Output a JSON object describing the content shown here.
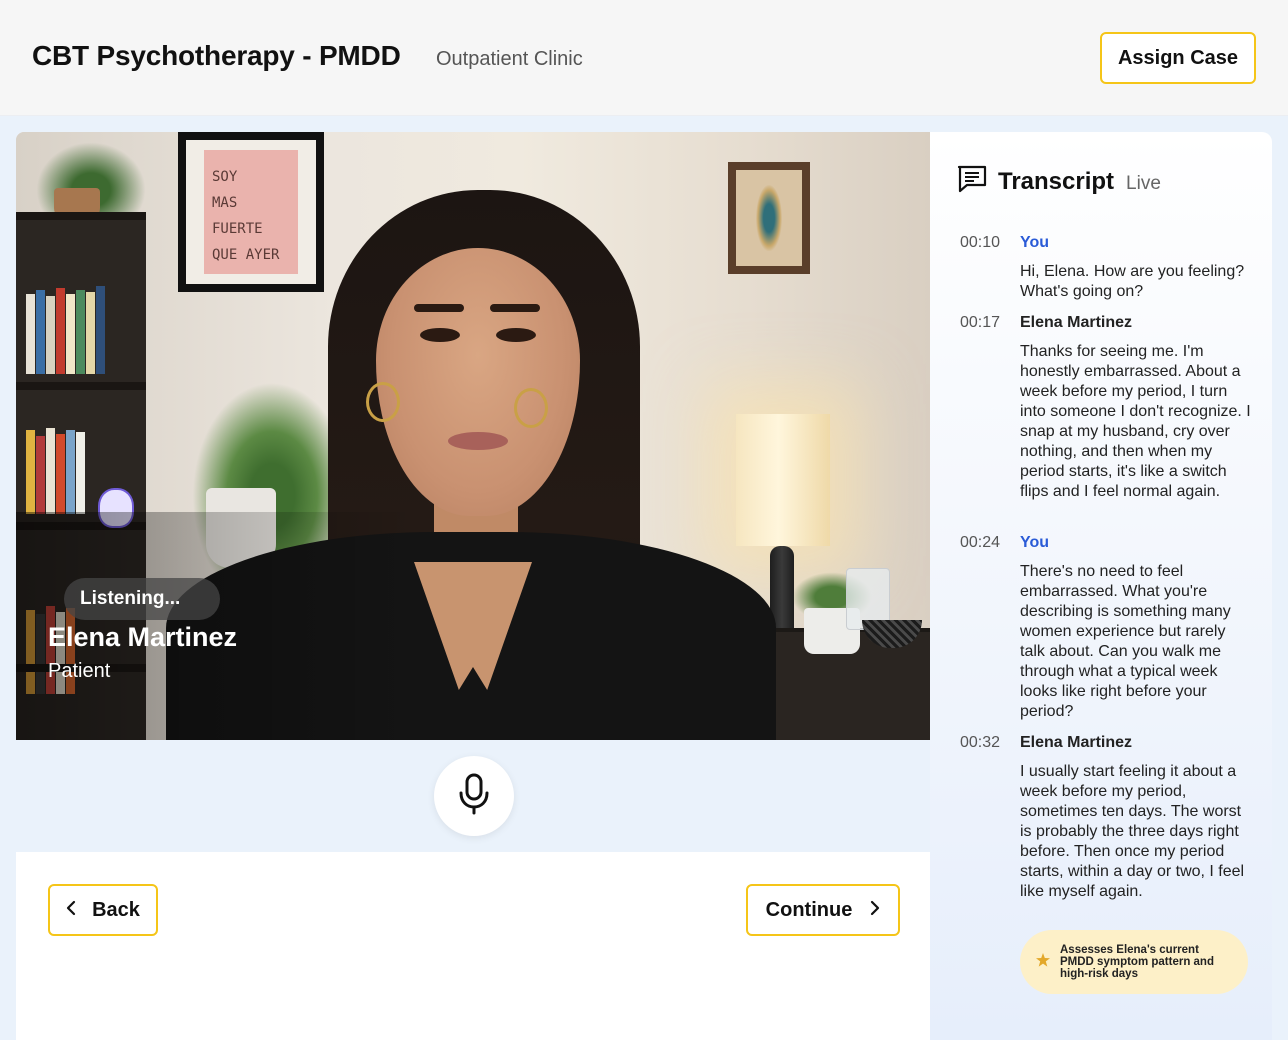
{
  "header": {
    "title": "CBT Psychotherapy - PMDD",
    "subtitle": "Outpatient Clinic",
    "assign_label": "Assign Case"
  },
  "video": {
    "status": "Listening...",
    "patient_name": "Elena Martinez",
    "patient_role": "Patient",
    "poster_lines": [
      "SOY",
      "MAS",
      "FUERTE",
      "QUE AYER"
    ]
  },
  "nav": {
    "back_label": "Back",
    "continue_label": "Continue"
  },
  "transcript": {
    "title": "Transcript",
    "status": "Live",
    "messages": [
      {
        "time": "00:10",
        "speaker": "You",
        "text": "Hi, Elena. How are you feeling? What's going on?"
      },
      {
        "time": "00:17",
        "speaker": "Elena Martinez",
        "text": "Thanks for seeing me. I'm honestly embarrassed. About a week before my period, I turn into someone I don't recognize. I snap at my husband, cry over nothing, and then when my period starts, it's like a switch flips and I feel normal again."
      },
      {
        "time": "00:24",
        "speaker": "You",
        "text": "There's no need to feel embarrassed. What you're describing is something many women experience but rarely talk about. Can you walk me through what a typical week looks like right before your period?"
      },
      {
        "time": "00:32",
        "speaker": "Elena Martinez",
        "text": "I usually start feeling it about a week before my period, sometimes ten days. The worst is probably the three days right before. Then once my period starts, within a day or two, I feel like myself again."
      }
    ],
    "badge": "Assesses Elena's current PMDD symptom pattern and high-risk days"
  },
  "colors": {
    "accent_border": "#f5c518",
    "you_speaker": "#2a5bd7",
    "badge_bg": "#fdf0c8",
    "page_bg": "#eaf2fb"
  },
  "icons": {
    "mic": "microphone-icon",
    "transcript": "chat-transcript-icon",
    "back": "chevron-left-icon",
    "continue": "chevron-right-icon",
    "badge": "star-icon"
  }
}
